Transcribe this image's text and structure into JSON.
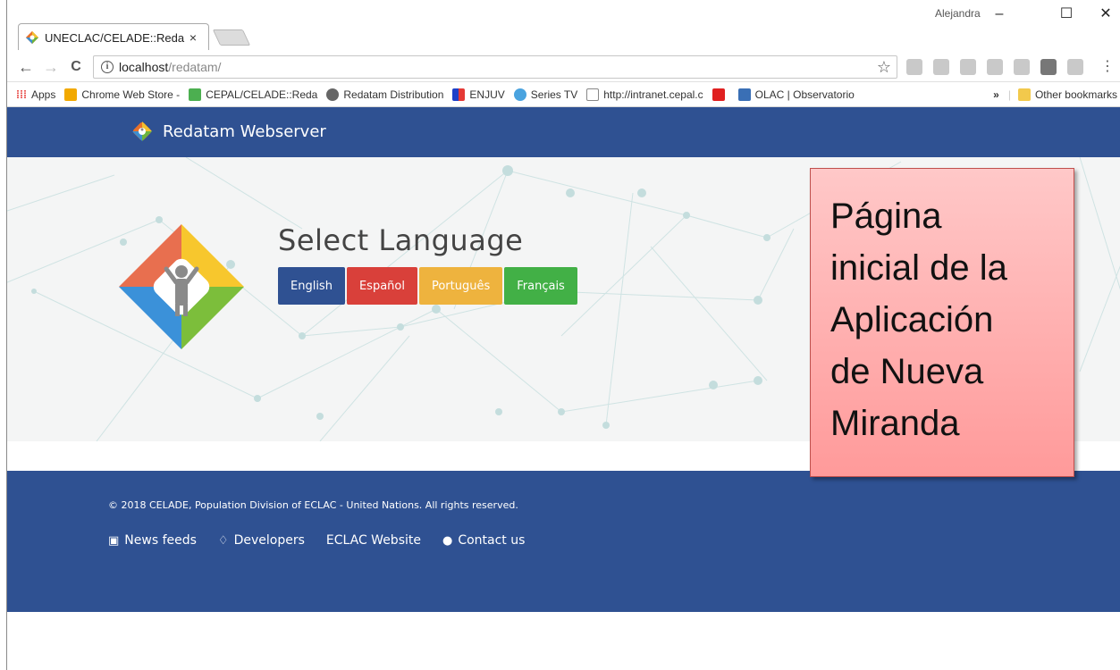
{
  "browser": {
    "tab_title": "UNECLAC/CELADE::Reda",
    "tab_close": "×",
    "user_name": "Alejandra",
    "window_controls": {
      "minimize": "–",
      "maximize": "☐",
      "close": "✕"
    },
    "url_host": "localhost",
    "url_path": "/redatam/",
    "nav": {
      "back": "←",
      "forward": "→",
      "reload": "C"
    }
  },
  "bookmarks": {
    "items": [
      {
        "label": "Apps",
        "color": "#e53935"
      },
      {
        "label": "Chrome Web Store -",
        "color": "#f2a900"
      },
      {
        "label": "CEPAL/CELADE::Reda",
        "color": "#4caf50"
      },
      {
        "label": "Redatam Distribution",
        "color": "#666666"
      },
      {
        "label": "ENJUV",
        "color": "#1e40c8"
      },
      {
        "label": "Series TV",
        "color": "#4aa3df"
      },
      {
        "label": "http://intranet.cepal.c",
        "color": "#999999"
      },
      {
        "label": "",
        "color": "#e02020"
      },
      {
        "label": "OLAC | Observatorio",
        "color": "#3a6fb5"
      }
    ],
    "overflow": "»",
    "other": "Other bookmarks"
  },
  "site": {
    "brand": "Redatam Webserver",
    "heading": "Select Language",
    "languages": [
      {
        "label": "English",
        "color": "#2f5192"
      },
      {
        "label": "Español",
        "color": "#d9403a"
      },
      {
        "label": "Português",
        "color": "#eeb33e"
      },
      {
        "label": "Français",
        "color": "#42b046"
      }
    ],
    "footer": {
      "copyright": "© 2018 CELADE, Population Division of ECLAC - United Nations. All rights reserved.",
      "links": [
        {
          "label": "News feeds",
          "icon": "rss-icon"
        },
        {
          "label": "Developers",
          "icon": "diamond-icon"
        },
        {
          "label": "ECLAC Website",
          "icon": ""
        },
        {
          "label": "Contact us",
          "icon": "user-icon"
        }
      ]
    }
  },
  "annotation": {
    "lines": [
      "Página",
      "inicial de la",
      "Aplicación",
      "de Nueva",
      "Miranda"
    ]
  },
  "colors": {
    "navbar": "#2f5192",
    "callout": "#ff9a9a"
  }
}
